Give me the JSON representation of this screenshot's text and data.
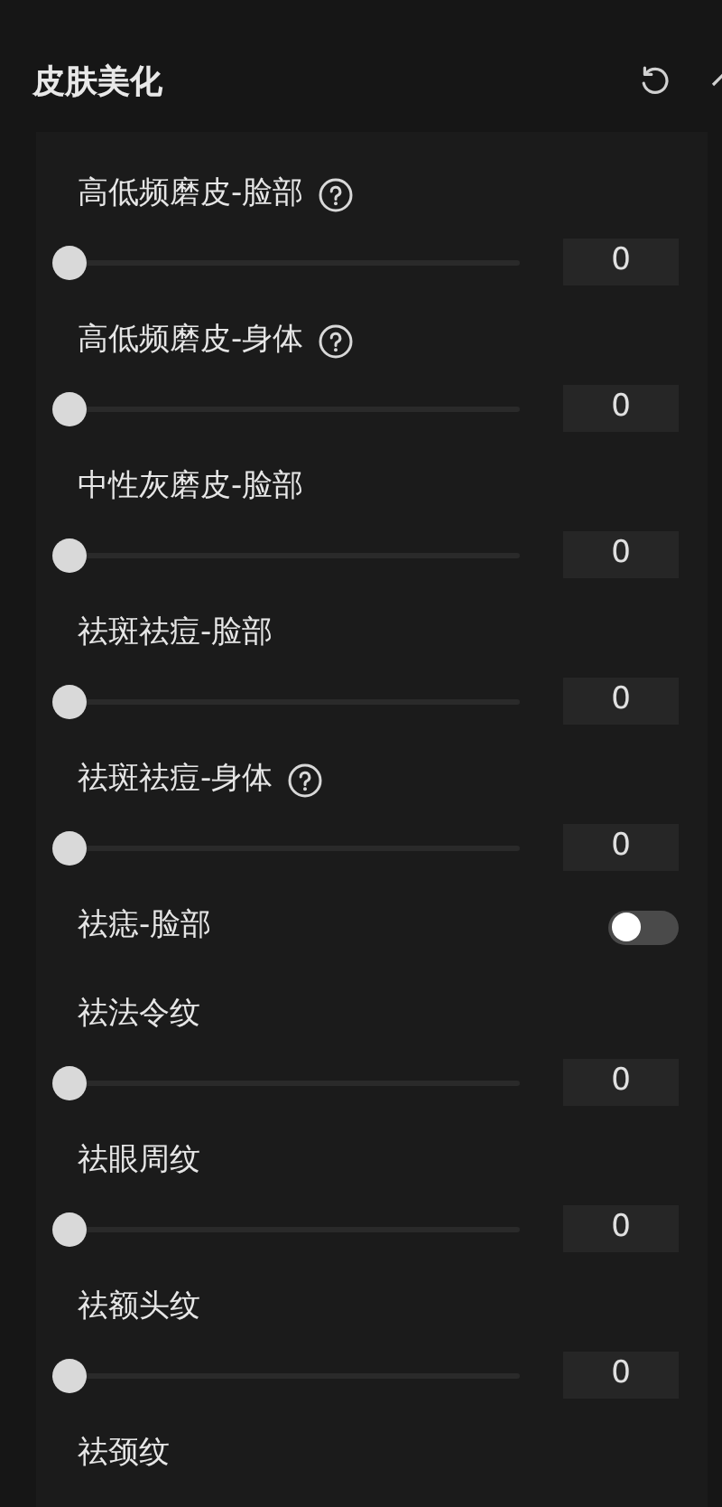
{
  "section": {
    "title": "皮肤美化",
    "expanded": true
  },
  "items": [
    {
      "kind": "slider",
      "label": "高低频磨皮-脸部",
      "help": true,
      "level": 0,
      "value": "0"
    },
    {
      "kind": "slider",
      "label": "高低频磨皮-身体",
      "help": true,
      "level": 0,
      "value": "0"
    },
    {
      "kind": "slider",
      "label": "中性灰磨皮-脸部",
      "help": false,
      "level": 0,
      "value": "0"
    },
    {
      "kind": "slider",
      "label": "祛斑祛痘-脸部",
      "help": false,
      "level": 0,
      "value": "0"
    },
    {
      "kind": "slider",
      "label": "祛斑祛痘-身体",
      "help": true,
      "level": 0,
      "value": "0"
    },
    {
      "kind": "toggle",
      "label": "祛痣-脸部",
      "help": false,
      "on": false
    },
    {
      "kind": "slider",
      "label": "祛法令纹",
      "help": false,
      "level": 0,
      "value": "0"
    },
    {
      "kind": "slider",
      "label": "祛眼周纹",
      "help": false,
      "level": 0,
      "value": "0"
    },
    {
      "kind": "slider",
      "label": "祛额头纹",
      "help": false,
      "level": 0,
      "value": "0"
    },
    {
      "kind": "label",
      "label": "祛颈纹",
      "help": false
    }
  ]
}
